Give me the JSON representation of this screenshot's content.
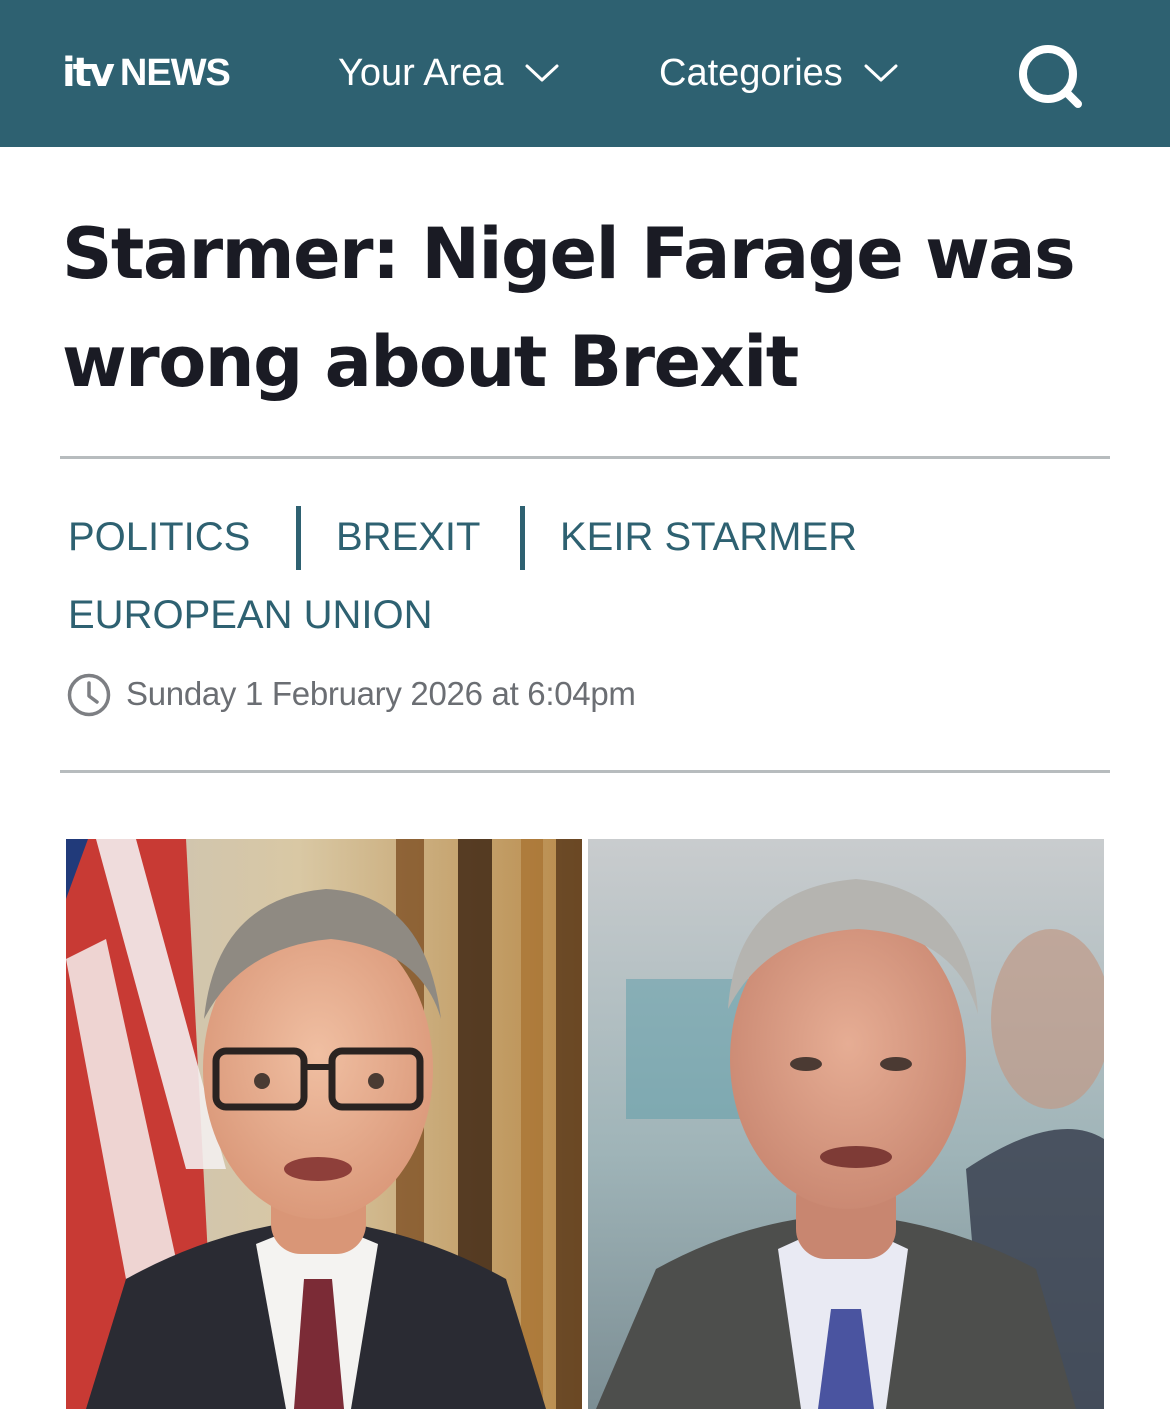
{
  "header": {
    "logo_itv": "itv",
    "logo_news": "NEWS",
    "nav": [
      {
        "label": "Your Area",
        "icon": "chevron-down-icon"
      },
      {
        "label": "Categories",
        "icon": "chevron-down-icon"
      }
    ],
    "search_icon": "search-icon",
    "background_color": "#2e6171"
  },
  "article": {
    "headline_line1": "Starmer: Nigel Farage was",
    "headline_line2": "wrong about Brexit",
    "tags": [
      "POLITICS",
      "BREXIT",
      "KEIR STARMER",
      "EUROPEAN UNION"
    ],
    "tag_color": "#2e6171",
    "clock_icon": "clock-icon",
    "published": "Sunday 1 February 2026 at 6:04pm",
    "hero_image": {
      "left_panel": "photo-keir-starmer",
      "right_panel": "photo-nigel-farage"
    }
  }
}
